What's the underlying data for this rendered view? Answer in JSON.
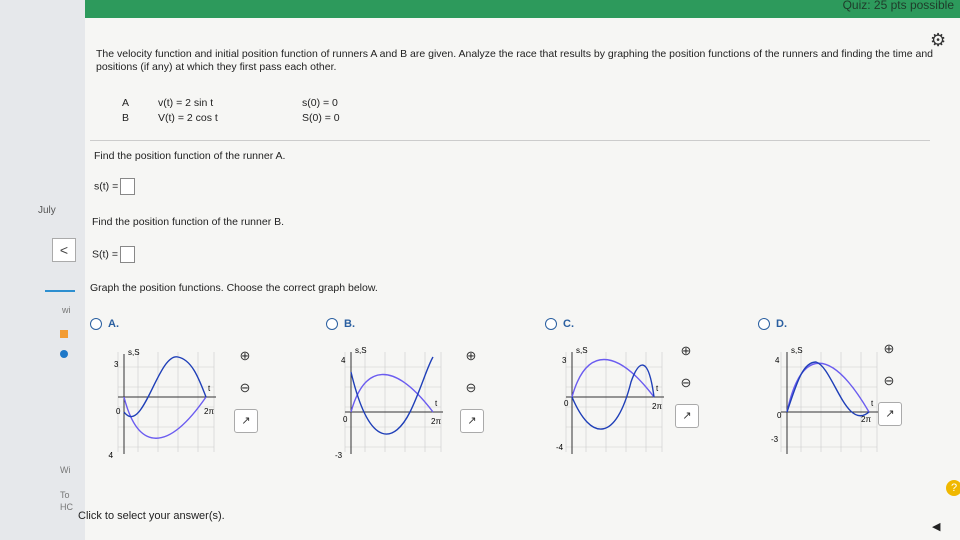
{
  "header": {
    "points": "Quiz: 25 pts possible"
  },
  "left": {
    "date": "July",
    "nav_prev": "<",
    "w1": "wi",
    "w2": "Wi",
    "t1": "To",
    "t2": "HC"
  },
  "question": {
    "intro": "The velocity function and initial position function of runners A and B are given. Analyze the race that results by graphing the position functions of the runners and finding the time and positions (if any) at which they first pass each other.",
    "rows": [
      {
        "runner": "A",
        "velocity": "v(t) = 2 sin t",
        "position": "s(0) = 0"
      },
      {
        "runner": "B",
        "velocity": "V(t) = 2 cos t",
        "position": "S(0) = 0"
      }
    ],
    "find_a": "Find the position function of the runner A.",
    "answer_a_label": "s(t) =",
    "find_b": "Find the position function of the runner B.",
    "answer_b_label": "S(t) =",
    "graph_prompt": "Graph the position functions. Choose the correct graph below.",
    "footer": "Click to select your answer(s)."
  },
  "options": [
    {
      "letter": "A.",
      "axis": "s,S",
      "ymax": "3",
      "ymin": "-4",
      "t": "t",
      "tmax": "2π",
      "zero": "0"
    },
    {
      "letter": "B.",
      "axis": "s,S",
      "ymax": "4",
      "ymin": "-3",
      "t": "t",
      "tmax": "2π",
      "zero": "0"
    },
    {
      "letter": "C.",
      "axis": "s,S",
      "ymax": "3",
      "ymin": "-4",
      "t": "t",
      "tmax": "2π",
      "zero": "0"
    },
    {
      "letter": "D.",
      "axis": "s,S",
      "ymax": "4",
      "ymin": "-3",
      "t": "t",
      "tmax": "2π",
      "zero": "0"
    }
  ],
  "tools": {
    "zoom_in": "⊕",
    "zoom_out": "⊖",
    "external": "↗"
  },
  "help": "?"
}
